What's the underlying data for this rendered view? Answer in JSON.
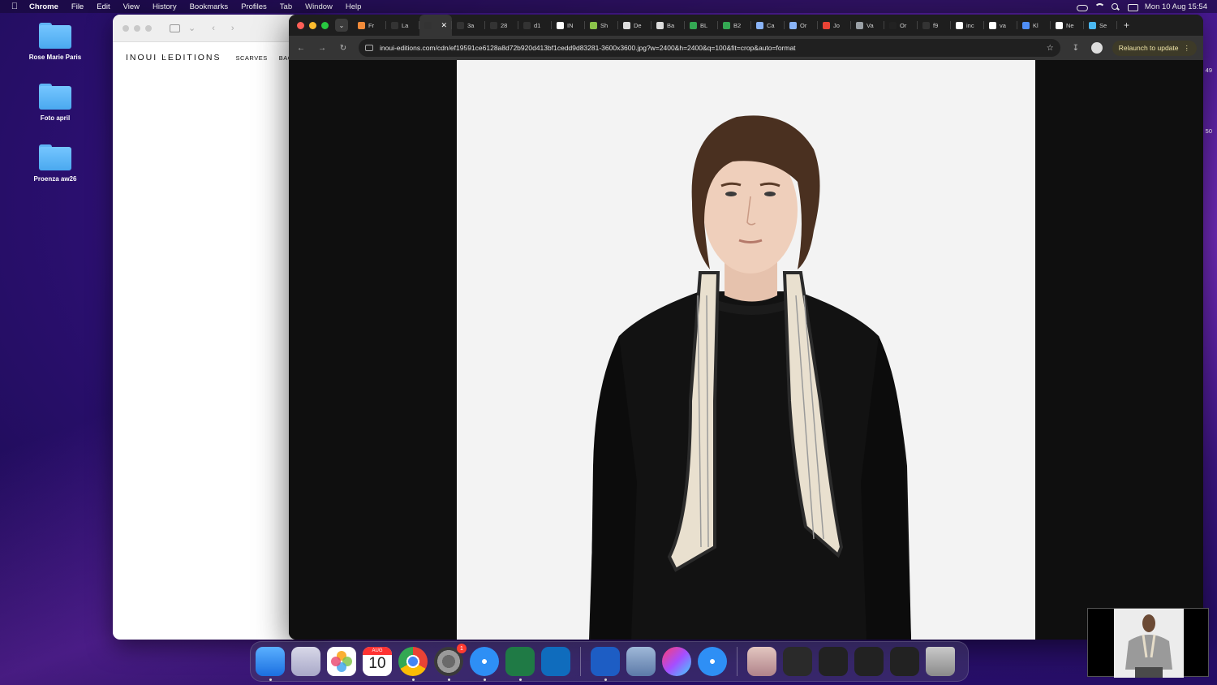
{
  "menubar": {
    "app": "Chrome",
    "menus": [
      "File",
      "Edit",
      "View",
      "History",
      "Bookmarks",
      "Profiles",
      "Tab",
      "Window",
      "Help"
    ],
    "datetime": "Mon 10 Aug  15:54"
  },
  "desktop": {
    "folders": [
      "Rose Marie Paris",
      "Foto april",
      "Proenza aw26"
    ]
  },
  "back_window": {
    "logo": "INOUI ĿEDITIONS",
    "nav": [
      "SCARVES",
      "BAGS"
    ]
  },
  "chrome": {
    "tabs": [
      {
        "label": "Fr",
        "color": "#f28b3a"
      },
      {
        "label": "La",
        "color": "#333333"
      },
      {
        "label": "",
        "color": "#333333",
        "active": true
      },
      {
        "label": "3a",
        "color": "#333333"
      },
      {
        "label": "28",
        "color": "#333333"
      },
      {
        "label": "d1",
        "color": "#333333"
      },
      {
        "label": "IN",
        "color": "#ffffff"
      },
      {
        "label": "Sh",
        "color": "#8bc34a"
      },
      {
        "label": "De",
        "color": "#dddddd"
      },
      {
        "label": "Ba",
        "color": "#dddddd"
      },
      {
        "label": "BL",
        "color": "#34a853"
      },
      {
        "label": "B2",
        "color": "#34a853"
      },
      {
        "label": "Ca",
        "color": "#8ab4f8"
      },
      {
        "label": "Or",
        "color": "#8ab4f8"
      },
      {
        "label": "Jo",
        "color": "#ea4335"
      },
      {
        "label": "Va",
        "color": "#9aa0a6"
      },
      {
        "label": "Or",
        "color": "#222222"
      },
      {
        "label": "f9",
        "color": "#333333"
      },
      {
        "label": "inc",
        "color": "#ffffff"
      },
      {
        "label": "va",
        "color": "#ffffff"
      },
      {
        "label": "Kl",
        "color": "#4f8ef7"
      },
      {
        "label": "Ne",
        "color": "#ffffff"
      },
      {
        "label": "Se",
        "color": "#4ab7f0"
      }
    ],
    "url": "inoui-editions.com/cdn/ef19591ce6128a8d72b920d413bf1cedd9d83281-3600x3600.jpg?w=2400&h=2400&q=100&fit=crop&auto=format",
    "relaunch_label": "Relaunch to update"
  },
  "right_edge_numbers": [
    "49",
    "50"
  ],
  "dock": {
    "calendar_month": "AUG",
    "calendar_day": "10",
    "settings_badge": "1"
  },
  "colors": {
    "accent": "#7a2fc8",
    "chrome_dark": "#1e1e1e",
    "relaunch_bg": "#3d3a28"
  }
}
